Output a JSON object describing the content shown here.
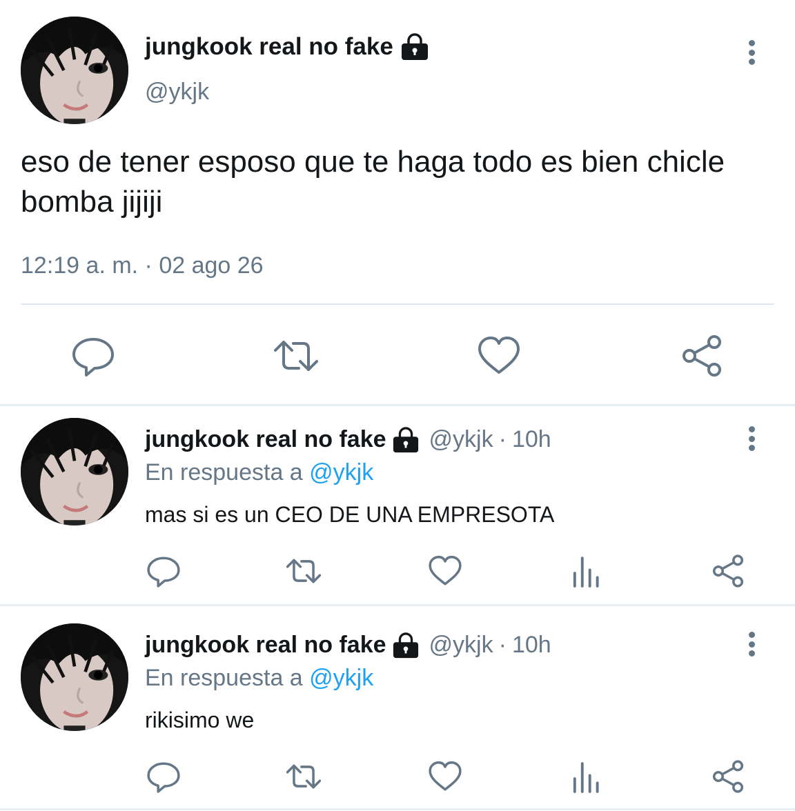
{
  "main_tweet": {
    "display_name": "jungkook real no fake",
    "handle": "@ykjk",
    "text": "eso de tener esposo que te haga todo es bien chicle bomba jijiji",
    "timestamp": "12:19 a. m. · 02 ago 26",
    "icons": [
      "lock-icon",
      "more-options-icon",
      "reply-icon",
      "retweet-icon",
      "like-icon",
      "share-icon"
    ]
  },
  "replies": [
    {
      "display_name": "jungkook real no fake",
      "handle": "@ykjk",
      "dot": "·",
      "time": "10h",
      "context_prefix": "En respuesta a",
      "context_handle": "@ykjk",
      "text": "mas si es un CEO DE UNA EMPRESOTA"
    },
    {
      "display_name": "jungkook real no fake",
      "handle": "@ykjk",
      "dot": "·",
      "time": "10h",
      "context_prefix": "En respuesta a",
      "context_handle": "@ykjk",
      "text": "rikisimo we"
    }
  ],
  "colors": {
    "text_primary": "#14171a",
    "text_secondary": "#657786",
    "link": "#1da1f2",
    "divider": "#e1e8ed"
  }
}
